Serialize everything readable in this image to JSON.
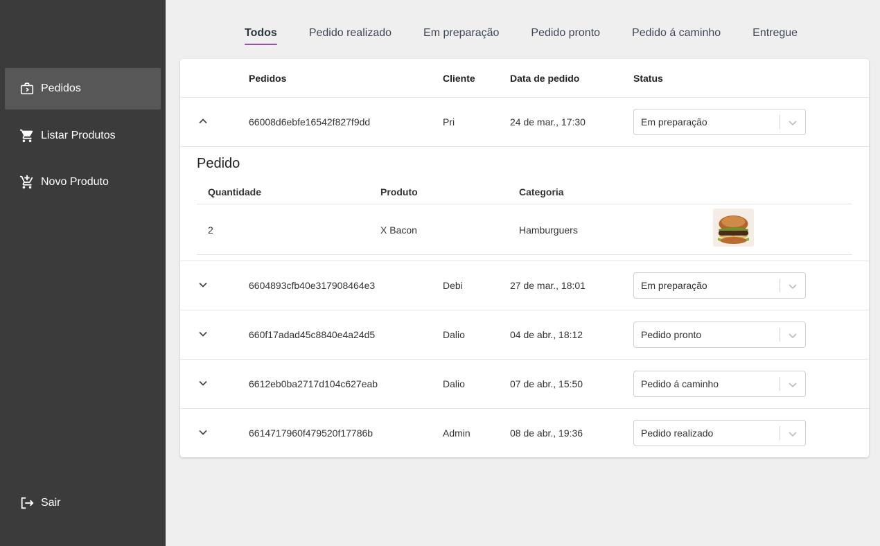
{
  "sidebar": {
    "items": [
      {
        "label": "Pedidos",
        "icon": "shopping-bag-icon",
        "active": true
      },
      {
        "label": "Listar Produtos",
        "icon": "cart-icon",
        "active": false
      },
      {
        "label": "Novo Produto",
        "icon": "cart-add-icon",
        "active": false
      }
    ],
    "logout": {
      "label": "Sair",
      "icon": "logout-icon"
    }
  },
  "tabs": [
    {
      "label": "Todos",
      "active": true
    },
    {
      "label": "Pedido realizado",
      "active": false
    },
    {
      "label": "Em preparação",
      "active": false
    },
    {
      "label": "Pedido pronto",
      "active": false
    },
    {
      "label": "Pedido á caminho",
      "active": false
    },
    {
      "label": "Entregue",
      "active": false
    }
  ],
  "table": {
    "headers": {
      "pedidos": "Pedidos",
      "cliente": "Cliente",
      "data": "Data de pedido",
      "status": "Status"
    },
    "rows": [
      {
        "id": "66008d6ebfe16542f827f9dd",
        "cliente": "Pri",
        "data": "24 de mar., 17:30",
        "status": "Em preparação",
        "expanded": true
      },
      {
        "id": "6604893cfb40e317908464e3",
        "cliente": "Debi",
        "data": "27 de mar., 18:01",
        "status": "Em preparação",
        "expanded": false
      },
      {
        "id": "660f17adad45c8840e4a24d5",
        "cliente": "Dalio",
        "data": "04 de abr., 18:12",
        "status": "Pedido pronto",
        "expanded": false
      },
      {
        "id": "6612eb0ba2717d104c627eab",
        "cliente": "Dalio",
        "data": "07 de abr., 15:50",
        "status": "Pedido á caminho",
        "expanded": false
      },
      {
        "id": "6614717960f479520f17786b",
        "cliente": "Admin",
        "data": "08 de abr., 19:36",
        "status": "Pedido realizado",
        "expanded": false
      }
    ]
  },
  "detail": {
    "title": "Pedido",
    "headers": {
      "quantidade": "Quantidade",
      "produto": "Produto",
      "categoria": "Categoria"
    },
    "items": [
      {
        "quantidade": "2",
        "produto": "X Bacon",
        "categoria": "Hamburguers"
      }
    ]
  },
  "colors": {
    "sidebar": "#3b3b3b",
    "sidebar_active": "#575757",
    "accent": "#9b4fb5",
    "background": "#efefef"
  }
}
